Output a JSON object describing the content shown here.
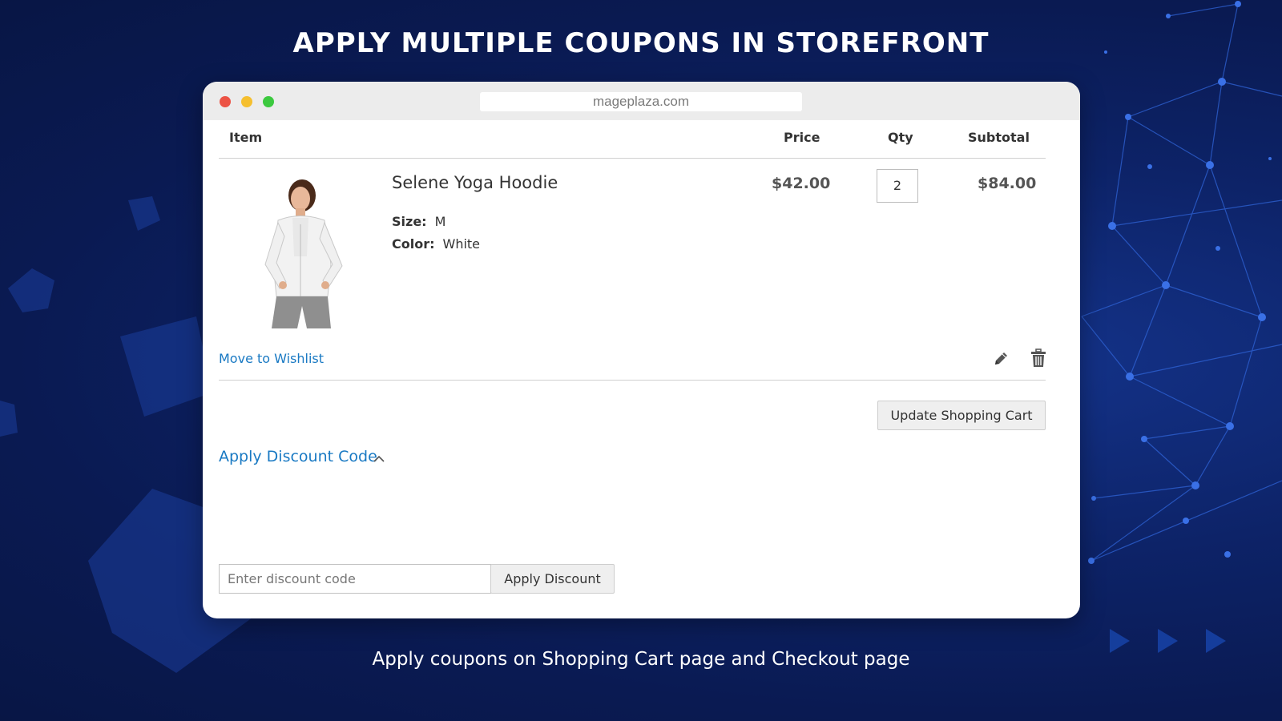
{
  "headline": "APPLY MULTIPLE COUPONS IN STOREFRONT",
  "caption": "Apply coupons on Shopping Cart page and Checkout page",
  "browser": {
    "url": "mageplaza.com"
  },
  "cart": {
    "columns": {
      "item": "Item",
      "price": "Price",
      "qty": "Qty",
      "subtotal": "Subtotal"
    },
    "item": {
      "name": "Selene Yoga Hoodie",
      "options": [
        {
          "label": "Size:",
          "value": "M"
        },
        {
          "label": "Color:",
          "value": "White"
        }
      ],
      "price": "$42.00",
      "qty": "2",
      "subtotal": "$84.00",
      "image_icon": "product-photo-icon"
    },
    "move_to_wishlist": "Move to Wishlist",
    "edit_icon": "pencil-icon",
    "delete_icon": "trash-icon",
    "update_button": "Update Shopping Cart"
  },
  "discount": {
    "title": "Apply Discount Code",
    "toggle_icon": "chevron-up-icon",
    "input_value": "",
    "input_placeholder": "Enter discount code",
    "apply_button": "Apply Discount"
  },
  "colors": {
    "background": "#0d2368",
    "link": "#1979c3",
    "traffic_red": "#ec5345",
    "traffic_yellow": "#f5bf2f",
    "traffic_green": "#3cc93f"
  }
}
